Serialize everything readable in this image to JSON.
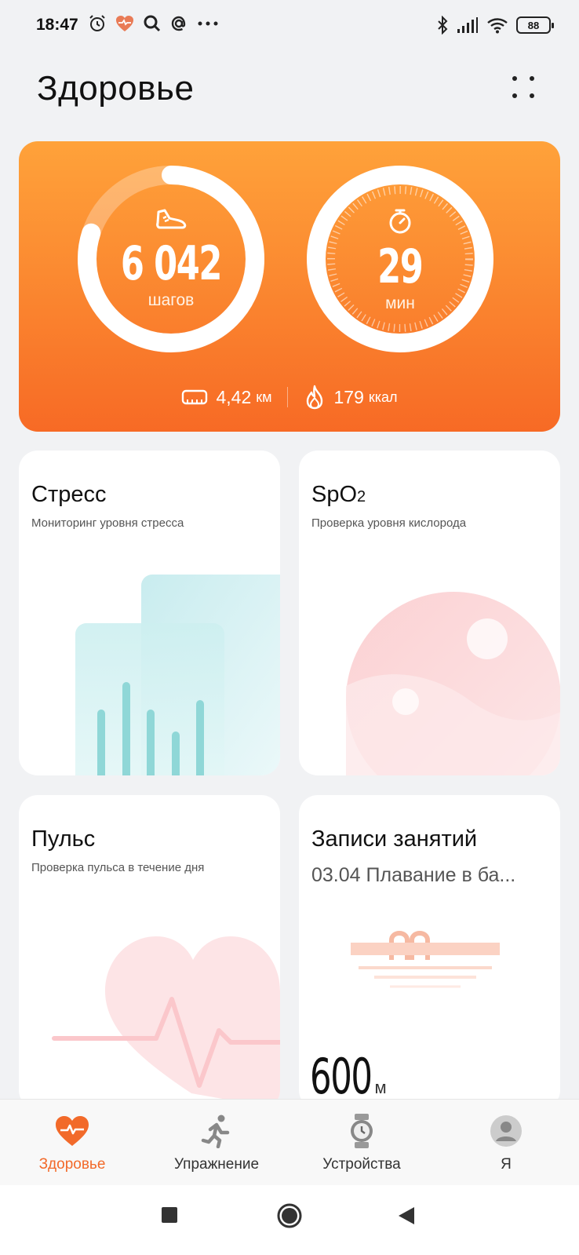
{
  "status_bar": {
    "time": "18:47",
    "battery": "88",
    "left_icons": [
      "alarm-icon",
      "health-heart-icon",
      "search-icon",
      "at-icon",
      "more-icon"
    ],
    "right_icons": [
      "bluetooth-icon",
      "signal-icon",
      "wifi-icon",
      "battery-icon"
    ]
  },
  "header": {
    "title": "Здоровье"
  },
  "activity": {
    "steps_value": "6 042",
    "steps_unit": "шагов",
    "steps_progress": 0.8,
    "minutes_value": "29",
    "minutes_unit": "мин",
    "distance_value": "4,42",
    "distance_unit": "км",
    "calories_value": "179",
    "calories_unit": "ккал",
    "colors": {
      "card_top": "#ffa23a",
      "card_bottom": "#f76a25"
    }
  },
  "cards": {
    "stress": {
      "title": "Стресс",
      "subtitle": "Мониторинг уровня стресса"
    },
    "spo2": {
      "title": "SpO",
      "title_sub": "2",
      "subtitle": "Проверка уровня кислорода"
    },
    "pulse": {
      "title": "Пульс",
      "subtitle": "Проверка пульса в течение дня"
    },
    "workouts": {
      "title": "Записи занятий",
      "subtitle": "03.04 Плавание в ба...",
      "value": "600",
      "unit": "м"
    }
  },
  "bottom_nav": {
    "items": [
      {
        "label": "Здоровье",
        "icon": "heart-icon",
        "active": true
      },
      {
        "label": "Упражнение",
        "icon": "runner-icon",
        "active": false
      },
      {
        "label": "Устройства",
        "icon": "watch-icon",
        "active": false
      },
      {
        "label": "Я",
        "icon": "avatar-icon",
        "active": false
      }
    ],
    "accent": "#f26a2a"
  },
  "system_nav": {
    "buttons": [
      "recents-button",
      "home-button",
      "back-button"
    ]
  }
}
